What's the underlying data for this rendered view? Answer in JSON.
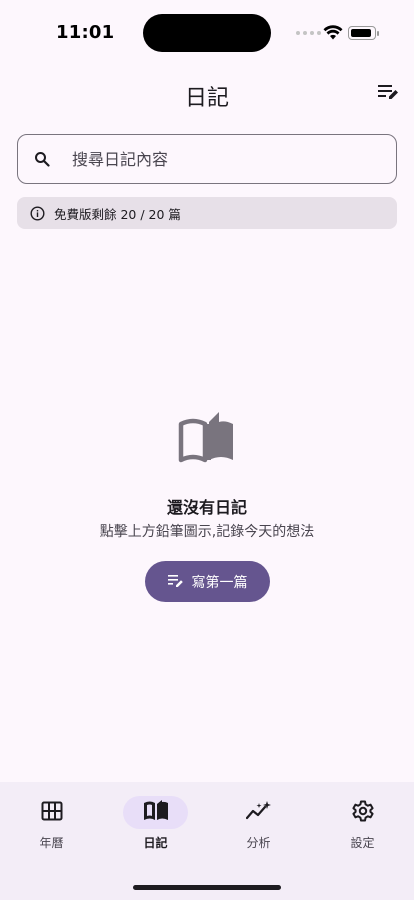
{
  "status_bar": {
    "time": "11:01"
  },
  "app_bar": {
    "title": "日記",
    "sort_icon": "sort-edit-icon"
  },
  "search": {
    "placeholder": "搜尋日記內容",
    "value": "",
    "icon": "search-icon"
  },
  "quota": {
    "icon": "info-icon",
    "text": "免費版剩餘 20 / 20 篇"
  },
  "empty_state": {
    "icon": "open-book-icon",
    "title": "還沒有日記",
    "subtitle": "點擊上方鉛筆圖示,記錄今天的想法",
    "button_label": "寫第一篇",
    "button_icon": "edit-list-icon"
  },
  "bottom_nav": {
    "items": [
      {
        "label": "年曆",
        "icon": "grid-calendar-icon",
        "active": false
      },
      {
        "label": "日記",
        "icon": "book-icon",
        "active": true
      },
      {
        "label": "分析",
        "icon": "sparkle-chart-icon",
        "active": false
      },
      {
        "label": "設定",
        "icon": "gear-icon",
        "active": false
      }
    ]
  },
  "colors": {
    "background": "#fdf7fd",
    "primary": "#65558f",
    "nav_background": "#f3edf7",
    "active_pill": "#e8def8",
    "banner": "#e7e0e8"
  }
}
